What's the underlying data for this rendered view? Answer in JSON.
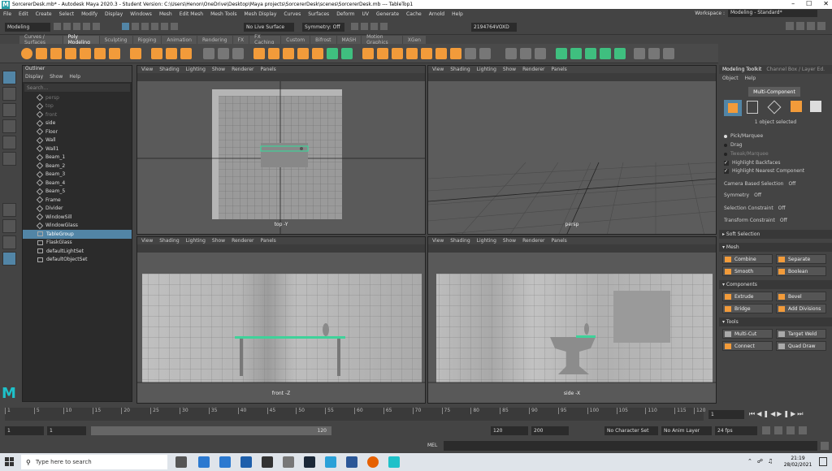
{
  "title": "SorcererDesk.mb* - Autodesk Maya 2020.3 - Student Version: C:\\Users\\Henon\\OneDrive\\Desktop\\Maya projects\\SorcererDesk\\scenes\\SorcererDesk.mb  ---  TableTop1",
  "menu": [
    "File",
    "Edit",
    "Create",
    "Select",
    "Modify",
    "Display",
    "Windows",
    "Mesh",
    "Edit Mesh",
    "Mesh Tools",
    "Mesh Display",
    "Curves",
    "Surfaces",
    "Deform",
    "UV",
    "Generate",
    "Cache",
    "Arnold",
    "Help"
  ],
  "workspace": {
    "label": "Workspace :",
    "value": "Modeling - Standard*"
  },
  "status": {
    "menuset": "Modeling",
    "live_surface": "No Live Surface",
    "symmetry": "Symmetry: Off",
    "user": "2194764VOXD"
  },
  "shelf_tabs": [
    "Curves / Surfaces",
    "Poly Modeling",
    "Sculpting",
    "Rigging",
    "Animation",
    "Rendering",
    "FX",
    "FX Caching",
    "Custom",
    "Bifrost",
    "MASH",
    "Motion Graphics",
    "XGen"
  ],
  "shelf_active": "Poly Modeling",
  "outliner": {
    "title": "Outliner",
    "menu": [
      "Display",
      "Show",
      "Help"
    ],
    "search_placeholder": "Search...",
    "items": [
      {
        "label": "persp",
        "state": "dim"
      },
      {
        "label": "top",
        "state": "dim"
      },
      {
        "label": "front",
        "state": "dim"
      },
      {
        "label": "side",
        "state": "normal"
      },
      {
        "label": "Floor",
        "state": "normal"
      },
      {
        "label": "Wall",
        "state": "normal"
      },
      {
        "label": "Wall1",
        "state": "normal"
      },
      {
        "label": "Beam_1",
        "state": "normal"
      },
      {
        "label": "Beam_2",
        "state": "normal"
      },
      {
        "label": "Beam_3",
        "state": "normal"
      },
      {
        "label": "Beam_4",
        "state": "normal"
      },
      {
        "label": "Beam_5",
        "state": "normal"
      },
      {
        "label": "Frame",
        "state": "normal"
      },
      {
        "label": "Divider",
        "state": "normal"
      },
      {
        "label": "WindowSill",
        "state": "normal"
      },
      {
        "label": "WindowGlass",
        "state": "normal"
      },
      {
        "label": "TableGroup",
        "state": "selected"
      },
      {
        "label": "FlaskGlass",
        "state": "normal"
      },
      {
        "label": "defaultLightSet",
        "state": "normal"
      },
      {
        "label": "defaultObjectSet",
        "state": "normal"
      }
    ]
  },
  "viewport_menu": [
    "View",
    "Shading",
    "Lighting",
    "Show",
    "Renderer",
    "Panels"
  ],
  "viewports": [
    {
      "label": "top -Y"
    },
    {
      "label": "persp"
    },
    {
      "label": "front -Z"
    },
    {
      "label": "side -X"
    }
  ],
  "toolkit": {
    "tabs": [
      "Modeling Toolkit",
      "Channel Box / Layer Ed."
    ],
    "menu": [
      "Object",
      "Help"
    ],
    "mode": "Multi-Component",
    "selected_text": "1 object selected",
    "pick_options": [
      "Pick/Marquee",
      "Drag",
      "Tweak/Marquee"
    ],
    "checks": [
      "Highlight Backfaces",
      "Highlight Nearest Component"
    ],
    "camera_based": "Camera Based Selection",
    "camera_based_val": "Off",
    "symmetry": "Symmetry",
    "symmetry_val": "Off",
    "sel_constraint": "Selection Constraint",
    "sel_constraint_val": "Off",
    "transform_constraint": "Transform Constraint",
    "transform_constraint_val": "Off",
    "soft_selection": "Soft Selection",
    "sections": {
      "mesh": "Mesh",
      "components": "Components",
      "tools": "Tools"
    },
    "mesh_buttons": [
      "Combine",
      "Separate",
      "Smooth",
      "Boolean"
    ],
    "component_buttons": [
      "Extrude",
      "Bevel",
      "Bridge",
      "Add Divisions"
    ],
    "tool_buttons": [
      "Multi-Cut",
      "Target Weld",
      "Connect",
      "Quad Draw"
    ]
  },
  "timeline": {
    "ticks": [
      "1",
      "5",
      "10",
      "15",
      "20",
      "25",
      "30",
      "35",
      "40",
      "45",
      "50",
      "55",
      "60",
      "65",
      "70",
      "75",
      "80",
      "85",
      "90",
      "95",
      "100",
      "105",
      "110",
      "115",
      "120"
    ],
    "current_frame": "1",
    "range_start": "1",
    "anim_start": "1",
    "range_mid": "120",
    "range_end": "120",
    "anim_end": "200",
    "char_set": "No Character Set",
    "anim_layer": "No Anim Layer",
    "fps": "24 fps"
  },
  "cmdline": {
    "lang": "MEL"
  },
  "taskbar": {
    "search_placeholder": "Type here to search",
    "time": "21:19",
    "date": "28/02/2021"
  }
}
